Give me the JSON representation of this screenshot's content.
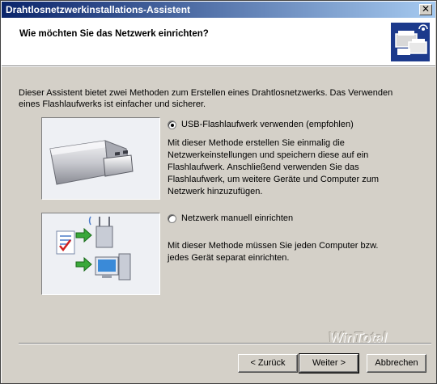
{
  "window": {
    "title": "Drahtlosnetzwerkinstallations-Assistent",
    "close_glyph": "✕"
  },
  "header": {
    "heading": "Wie möchten Sie das Netzwerk einrichten?",
    "icon": "wireless-network-wizard-icon"
  },
  "intro": "Dieser Assistent bietet zwei Methoden zum Erstellen eines Drahtlosnetzwerks. Das Verwenden eines Flashlaufwerks ist einfacher und sicherer.",
  "options": [
    {
      "label": "USB-Flashlaufwerk verwenden (empfohlen)",
      "selected": true,
      "description": "Mit dieser Methode erstellen Sie einmalig die Netzwerkeinstellungen und speichern diese auf ein Flashlaufwerk. Anschließend verwenden Sie das Flashlaufwerk, um weitere Geräte und Computer zum Netzwerk hinzuzufügen.",
      "image": "usb-flash-drive-icon"
    },
    {
      "label": "Netzwerk manuell einrichten",
      "selected": false,
      "description": "Mit dieser Methode müssen Sie jeden Computer bzw. jedes Gerät separat einrichten.",
      "image": "manual-network-setup-icon"
    }
  ],
  "watermark": "WinTotal",
  "buttons": {
    "back": "< Zurück",
    "next": "Weiter >",
    "cancel": "Abbrechen"
  }
}
